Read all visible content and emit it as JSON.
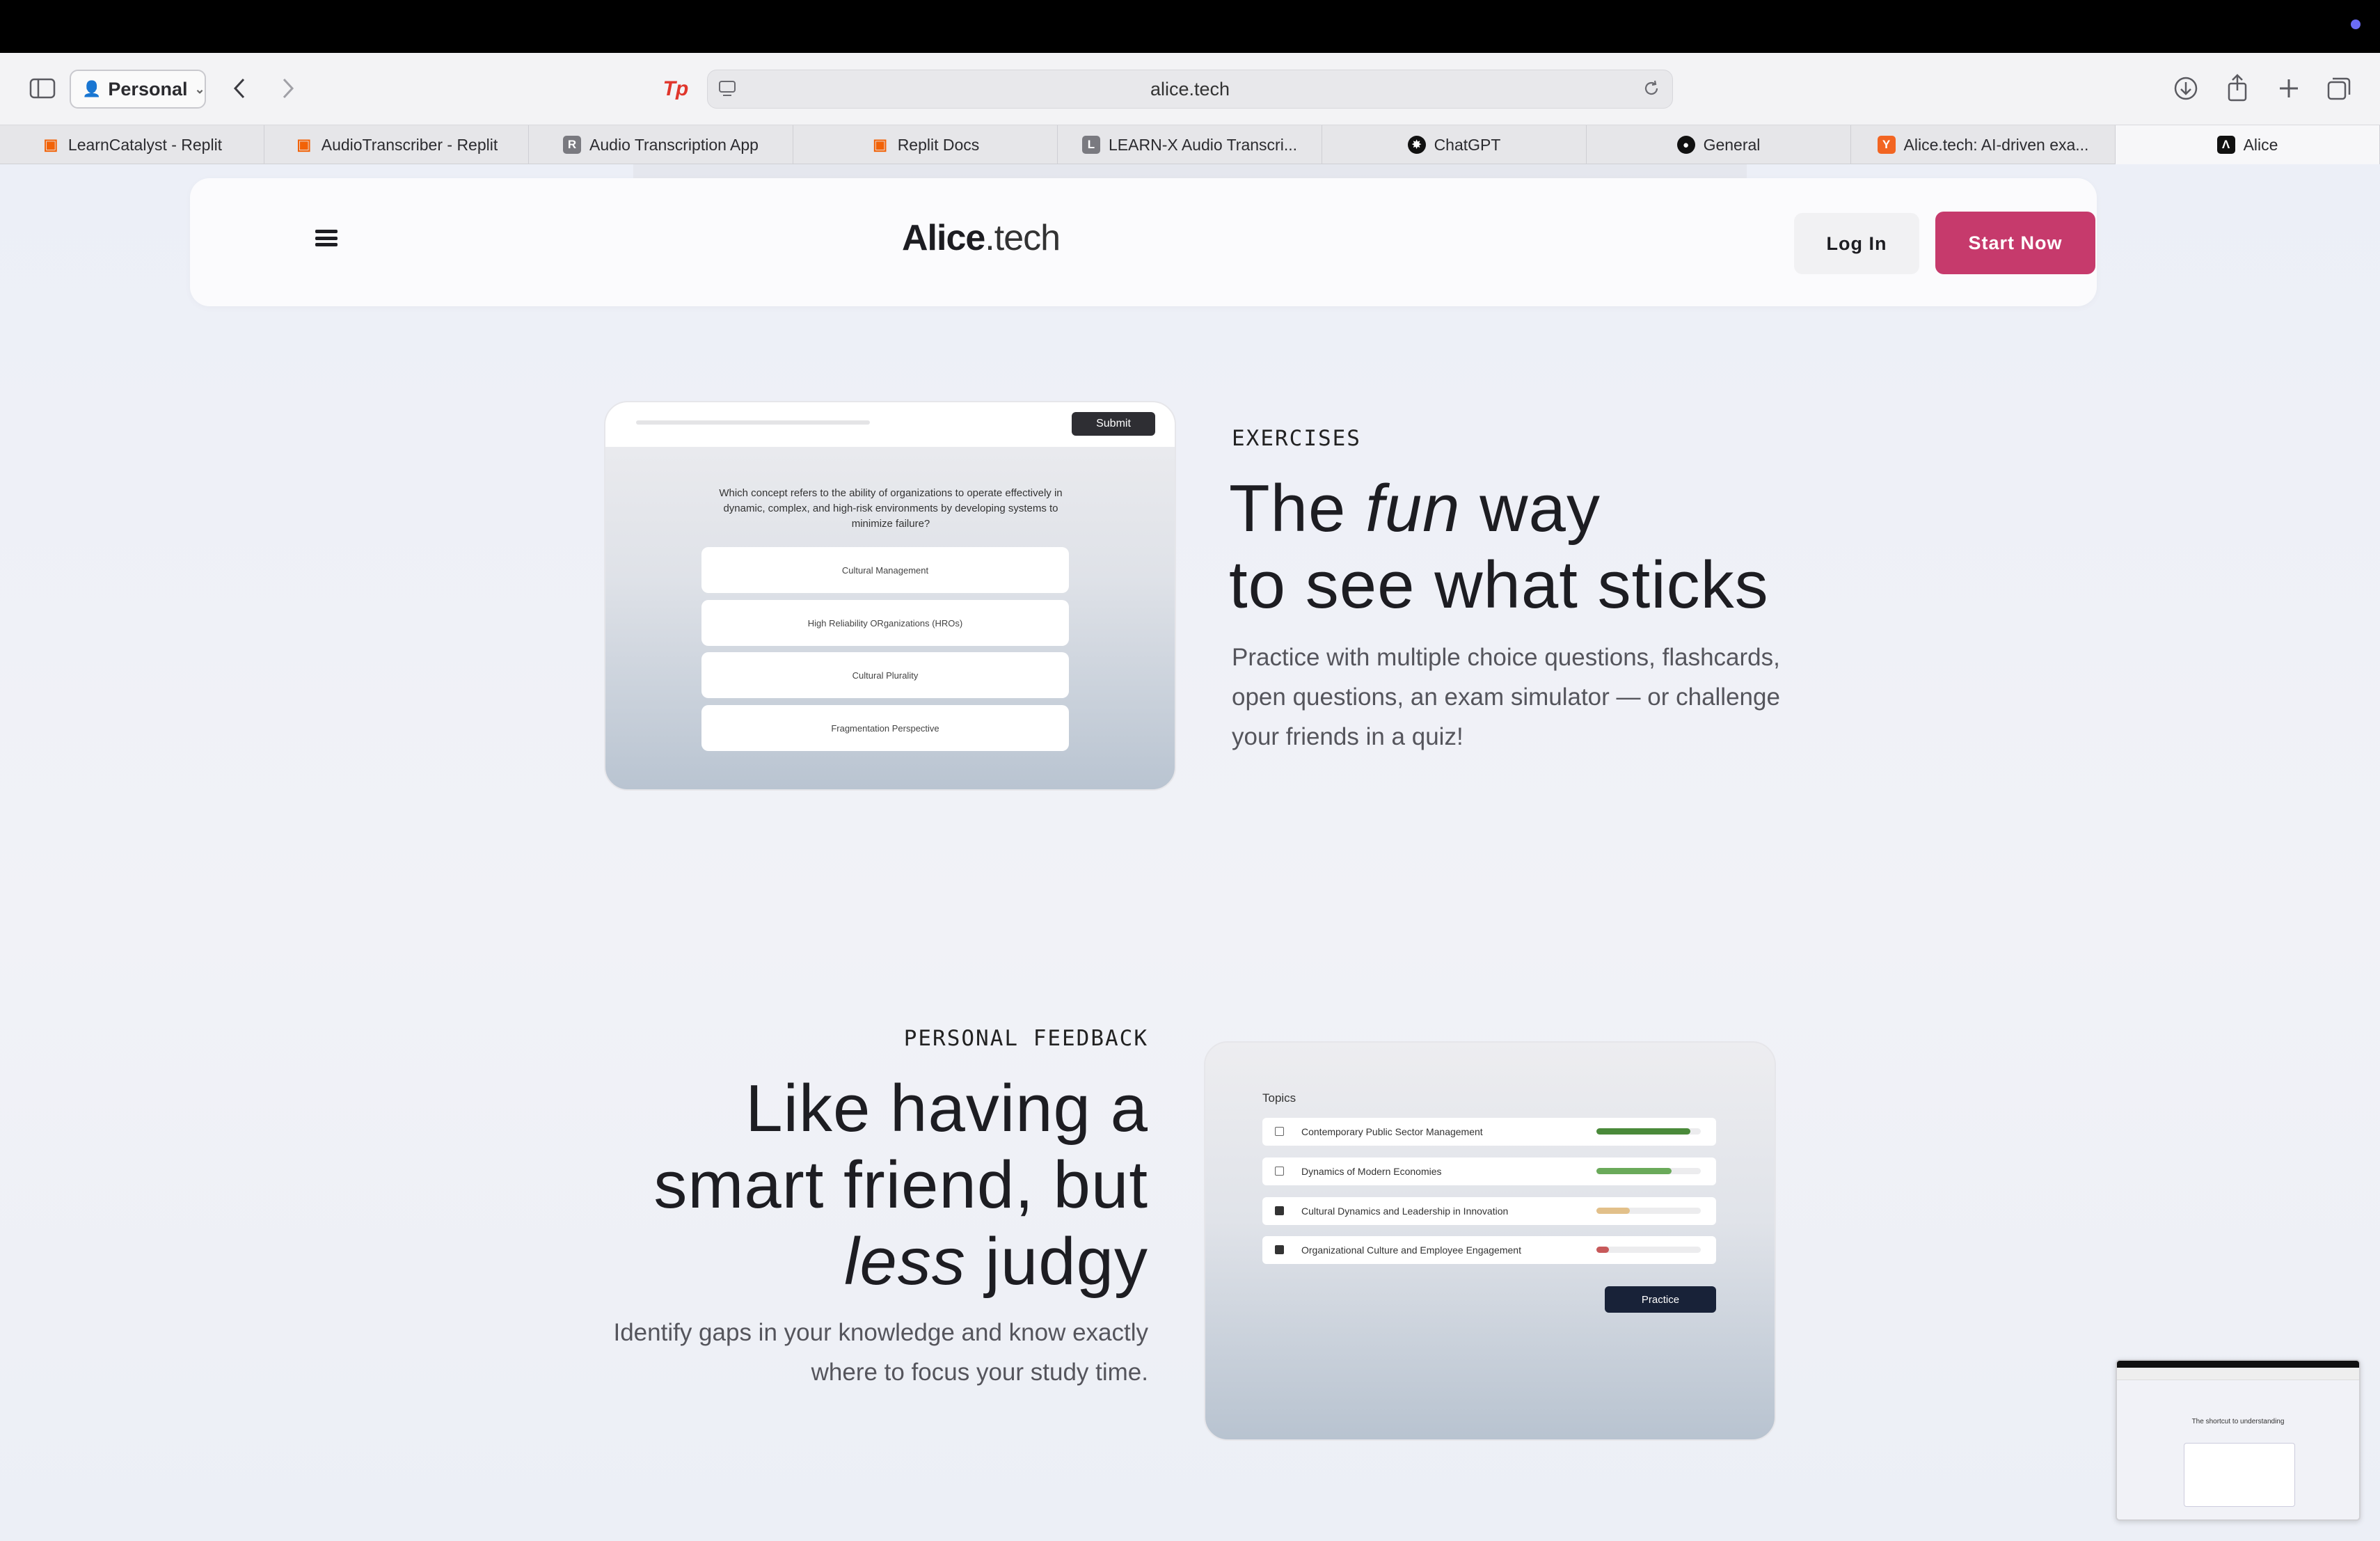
{
  "browser": {
    "profile": "Personal",
    "address": "alice.tech",
    "tabs": [
      {
        "label": "LearnCatalyst - Replit",
        "icon": "replit-icon",
        "color": "#f26207"
      },
      {
        "label": "AudioTranscriber - Replit",
        "icon": "replit-icon",
        "color": "#f26207"
      },
      {
        "label": "Audio Transcription App",
        "icon": "R",
        "color": "#7a7a80"
      },
      {
        "label": "Replit Docs",
        "icon": "replit-icon",
        "color": "#f26207"
      },
      {
        "label": "LEARN-X Audio Transcri...",
        "icon": "L",
        "color": "#7a7a80"
      },
      {
        "label": "ChatGPT",
        "icon": "openai-icon",
        "color": "#111111"
      },
      {
        "label": "General",
        "icon": "github-icon",
        "color": "#111111"
      },
      {
        "label": "Alice.tech: AI-driven exa...",
        "icon": "Y",
        "color": "#f26522"
      },
      {
        "label": "Alice",
        "icon": "Λ",
        "color": "#111111"
      }
    ]
  },
  "nav": {
    "logo_bold": "Alice",
    "logo_light": ".tech",
    "login": "Log In",
    "start": "Start Now"
  },
  "exercises": {
    "eyebrow": "EXERCISES",
    "title_line1_a": "The ",
    "title_line1_em": "fun",
    "title_line1_b": " way",
    "title_line2": "to see what sticks",
    "body": "Practice with multiple choice questions, flashcards, open questions, an exam simulator — or challenge your friends in a quiz!",
    "mock": {
      "submit": "Submit",
      "question": "Which concept refers to the ability of organizations to operate effectively in dynamic, complex, and high-risk environments by developing systems to minimize failure?",
      "options": [
        "Cultural Management",
        "High Reliability ORganizations (HROs)",
        "Cultural Plurality",
        "Fragmentation Perspective"
      ]
    }
  },
  "feedback": {
    "eyebrow": "PERSONAL FEEDBACK",
    "title_line1": "Like having a",
    "title_line2": "smart friend, but",
    "title_line3_em": "less",
    "title_line3_b": " judgy",
    "body_line1": "Identify gaps in your knowledge and know exactly",
    "body_line2": "where to focus your study time.",
    "mock": {
      "heading": "Topics",
      "practice": "Practice",
      "topics": [
        {
          "label": "Contemporary Public Sector Management",
          "checked": false,
          "progress": 0.9,
          "color": "#4a8a3a"
        },
        {
          "label": "Dynamics of Modern Economies",
          "checked": false,
          "progress": 0.72,
          "color": "#6aaa5a"
        },
        {
          "label": "Cultural Dynamics and Leadership in Innovation",
          "checked": true,
          "progress": 0.32,
          "color": "#e2c08a"
        },
        {
          "label": "Organizational Culture and Employee Engagement",
          "checked": true,
          "progress": 0.12,
          "color": "#c7595a"
        }
      ]
    }
  },
  "thumbnail": {
    "heading": "The shortcut to understanding"
  }
}
